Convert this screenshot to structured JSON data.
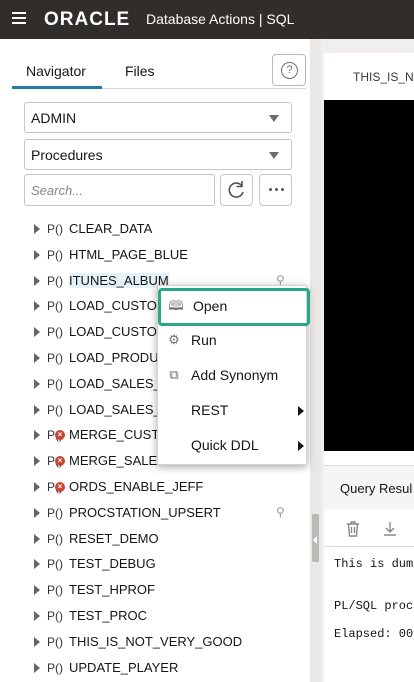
{
  "header": {
    "logo_text": "ORACLE",
    "app_title": "Database Actions |  SQL"
  },
  "navigator": {
    "tabs": [
      "Navigator",
      "Files"
    ],
    "active_tab": "Navigator",
    "schema_select": "ADMIN",
    "object_type_select": "Procedures",
    "search_placeholder": "Search...",
    "items": [
      {
        "prefix": "P()",
        "name": "CLEAR_DATA",
        "invalid": false,
        "pinned": false
      },
      {
        "prefix": "P()",
        "name": "HTML_PAGE_BLUE",
        "invalid": false,
        "pinned": false
      },
      {
        "prefix": "P()",
        "name": "ITUNES_ALBUM",
        "invalid": false,
        "pinned": true,
        "selected": true
      },
      {
        "prefix": "P()",
        "name": "LOAD_CUSTOM",
        "invalid": false,
        "pinned": false
      },
      {
        "prefix": "P()",
        "name": "LOAD_CUSTOM",
        "invalid": false,
        "pinned": false
      },
      {
        "prefix": "P()",
        "name": "LOAD_PRODU",
        "invalid": false,
        "pinned": false
      },
      {
        "prefix": "P()",
        "name": "LOAD_SALES_U",
        "invalid": false,
        "pinned": false
      },
      {
        "prefix": "P()",
        "name": "LOAD_SALES_U",
        "invalid": false,
        "pinned": false
      },
      {
        "prefix": "P()",
        "name": "MERGE_CUSTO",
        "invalid": true,
        "pinned": false
      },
      {
        "prefix": "P()",
        "name": "MERGE_SALES",
        "invalid": true,
        "pinned": false
      },
      {
        "prefix": "P()",
        "name": "ORDS_ENABLE_JEFF",
        "invalid": true,
        "pinned": false
      },
      {
        "prefix": "P()",
        "name": "PROCSTATION_UPSERT",
        "invalid": false,
        "pinned": true
      },
      {
        "prefix": "P()",
        "name": "RESET_DEMO",
        "invalid": false,
        "pinned": false
      },
      {
        "prefix": "P()",
        "name": "TEST_DEBUG",
        "invalid": false,
        "pinned": false
      },
      {
        "prefix": "P()",
        "name": "TEST_HPROF",
        "invalid": false,
        "pinned": false
      },
      {
        "prefix": "P()",
        "name": "TEST_PROC",
        "invalid": false,
        "pinned": false
      },
      {
        "prefix": "P()",
        "name": "THIS_IS_NOT_VERY_GOOD",
        "invalid": false,
        "pinned": false
      },
      {
        "prefix": "P()",
        "name": "UPDATE_PLAYER",
        "invalid": false,
        "pinned": false
      }
    ]
  },
  "context_menu": {
    "items": [
      {
        "label": "Open",
        "icon": "book-open-icon",
        "submenu": false,
        "focused": true
      },
      {
        "label": "Run",
        "icon": "gear-icon",
        "submenu": false,
        "focused": false
      },
      {
        "label": "Add Synonym",
        "icon": "copy-icon",
        "submenu": false,
        "focused": false
      },
      {
        "label": "REST",
        "icon": "",
        "submenu": true,
        "focused": false
      },
      {
        "label": "Quick DDL",
        "icon": "",
        "submenu": true,
        "focused": false
      }
    ]
  },
  "editor": {
    "tab_label": "THIS_IS_N"
  },
  "results": {
    "tab_label": "Query Resul",
    "output_lines": [
      "This is dum",
      "",
      "PL/SQL proc",
      "",
      "Elapsed: 00"
    ]
  },
  "colors": {
    "accent": "#227e9e",
    "focus_ring": "#29a787",
    "invalid_badge": "#c74634",
    "header_bg": "#312d2a"
  }
}
